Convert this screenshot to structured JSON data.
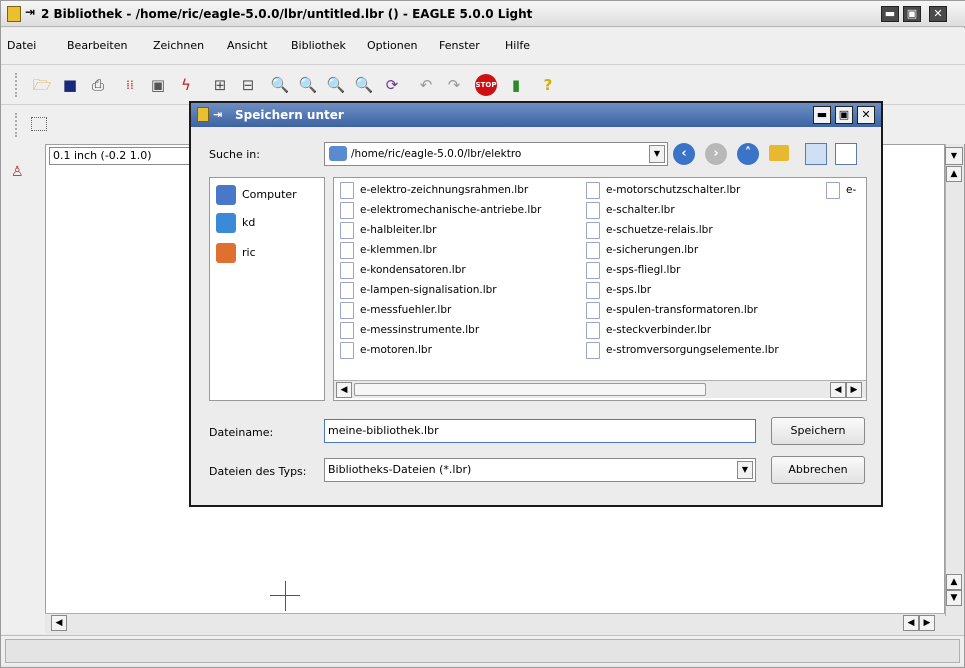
{
  "window": {
    "title": "2 Bibliothek - /home/ric/eagle-5.0.0/lbr/untitled.lbr () - EAGLE 5.0.0 Light",
    "controls": [
      "▬",
      "▣",
      "✕"
    ]
  },
  "menu": [
    "Datei",
    "Bearbeiten",
    "Zeichnen",
    "Ansicht",
    "Bibliothek",
    "Optionen",
    "Fenster",
    "Hilfe"
  ],
  "toolbar": {
    "icons": [
      "open-icon",
      "save-icon",
      "print-icon",
      "cam-icon",
      "board-icon",
      "schematic-icon",
      "library-icon",
      "library2-icon",
      "zoom-fit-icon",
      "zoom-in-icon",
      "zoom-out-icon",
      "zoom-select-icon",
      "redraw-icon",
      "undo-icon",
      "redo-icon",
      "stop-icon",
      "go-icon",
      "help-icon"
    ]
  },
  "coordinate": "0.1 inch (-0.2 1.0)",
  "dialog": {
    "title": "Speichern unter",
    "look_in_label": "Suche in:",
    "look_in_value": "/home/ric/eagle-5.0.0/lbr/elektro",
    "places": [
      "Computer",
      "kd",
      "ric"
    ],
    "files_col1": [
      "e-elektro-zeichnungsrahmen.lbr",
      "e-elektromechanische-antriebe.lbr",
      "e-halbleiter.lbr",
      "e-klemmen.lbr",
      "e-kondensatoren.lbr",
      "e-lampen-signalisation.lbr",
      "e-messfuehler.lbr",
      "e-messinstrumente.lbr",
      "e-motoren.lbr"
    ],
    "files_col2": [
      "e-motorschutzschalter.lbr",
      "e-schalter.lbr",
      "e-schuetze-relais.lbr",
      "e-sicherungen.lbr",
      "e-sps-fliegl.lbr",
      "e-sps.lbr",
      "e-spulen-transformatoren.lbr",
      "e-steckverbinder.lbr",
      "e-stromversorgungselemente.lbr"
    ],
    "files_col3": [
      "e-"
    ],
    "filename_label": "Dateiname:",
    "filename_value": "meine-bibliothek.lbr",
    "filetype_label": "Dateien des Typs:",
    "filetype_value": "Bibliotheks-Dateien (*.lbr)",
    "save_button": "Speichern",
    "cancel_button": "Abbrechen"
  }
}
